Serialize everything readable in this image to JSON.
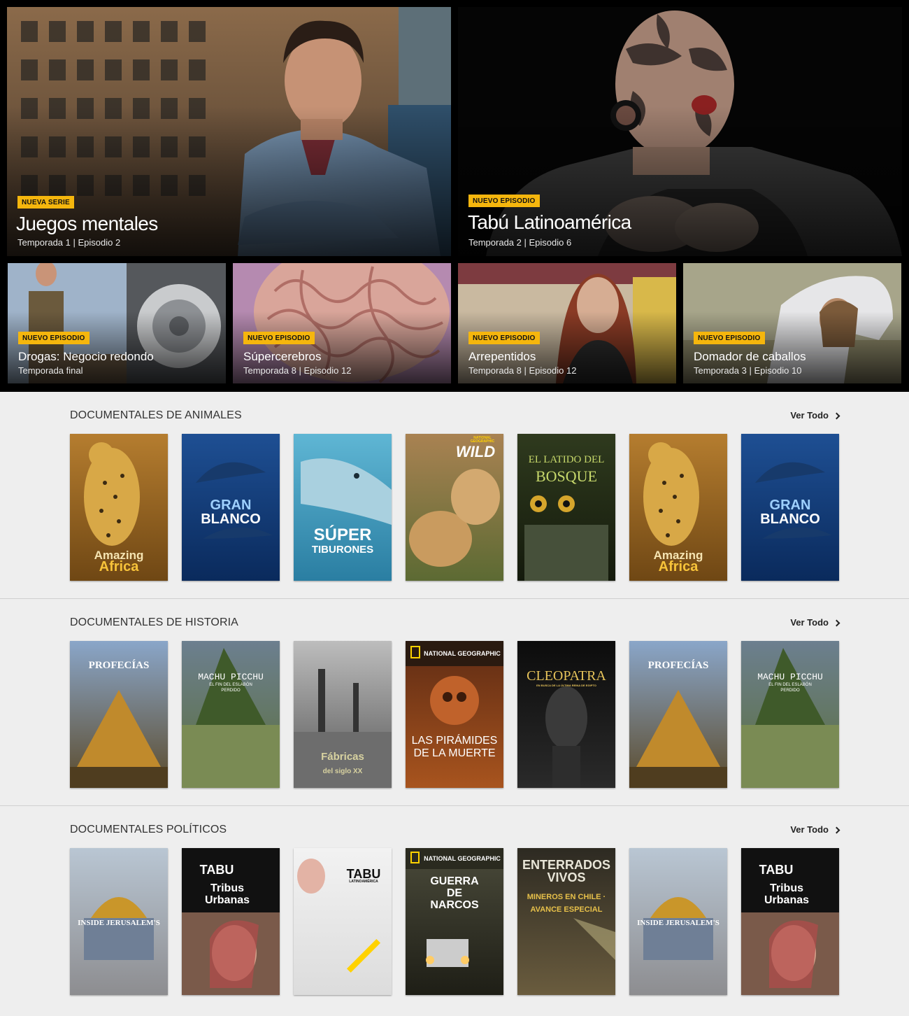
{
  "hero": {
    "featured": [
      {
        "badge": "NUEVA SERIE",
        "title": "Juegos mentales",
        "subtitle": "Temporada 1 | Episodio 2"
      },
      {
        "badge": "NUEVO EPISODIO",
        "title": "Tabú Latinoamérica",
        "subtitle": "Temporada 2 | Episodio 6"
      }
    ],
    "episodes": [
      {
        "badge": "NUEVO EPISODIO",
        "title": "Drogas: Negocio redondo",
        "subtitle": "Temporada final"
      },
      {
        "badge": "NUEVO EPISODIO",
        "title": "Súpercerebros",
        "subtitle": "Temporada 8 | Episodio 12"
      },
      {
        "badge": "NUEVO EPISODIO",
        "title": "Arrepentidos",
        "subtitle": "Temporada 8 | Episodio 12"
      },
      {
        "badge": "NUEVO EPISODIO",
        "title": "Domador de caballos",
        "subtitle": "Temporada 3 | Episodio 10"
      }
    ]
  },
  "rows": [
    {
      "title": "DOCUMENTALES DE ANIMALES",
      "see_all": "Ver Todo",
      "posters": [
        {
          "line1": "Amazing",
          "line2": "Africa"
        },
        {
          "line1": "GRAN",
          "line2": "BLANCO"
        },
        {
          "line1": "SÚPER",
          "line2": "TIBURONES"
        },
        {
          "line1": "WILD",
          "line2": "NATIONAL GEOGRAPHIC"
        },
        {
          "line1": "EL LATIDO DEL",
          "line2": "BOSQUE"
        },
        {
          "line1": "Amazing",
          "line2": "Africa"
        },
        {
          "line1": "GRAN",
          "line2": "BLANCO"
        }
      ]
    },
    {
      "title": "DOCUMENTALES DE HISTORIA",
      "see_all": "Ver Todo",
      "posters": [
        {
          "line1": "PROFECÍAS",
          "line2": ""
        },
        {
          "line1": "MACHU PICCHU",
          "line2": "EL FIN DEL ESLABÓN PERDIDO"
        },
        {
          "line1": "Fábricas",
          "line2": "del siglo XX"
        },
        {
          "line1": "NATIONAL GEOGRAPHIC",
          "line2": "LAS PIRÁMIDES DE LA MUERTE"
        },
        {
          "line1": "CLEOPATRA",
          "line2": "EN BUSCA DE LA ÚLTIMA REINA DE EGIPTO"
        },
        {
          "line1": "PROFECÍAS",
          "line2": ""
        },
        {
          "line1": "MACHU PICCHU",
          "line2": "EL FIN DEL ESLABÓN PERDIDO"
        }
      ]
    },
    {
      "title": "DOCUMENTALES POLÍTICOS",
      "see_all": "Ver Todo",
      "posters": [
        {
          "line1": "INSIDE JERUSALEM'S",
          "line2": ""
        },
        {
          "line1": "TABU",
          "line2": "Tribus Urbanas"
        },
        {
          "line1": "TABU",
          "line2": "LATINOAMÉRICA"
        },
        {
          "line1": "NATIONAL GEOGRAPHIC",
          "line2": "GUERRA DE NARCOS"
        },
        {
          "line1": "ENTERRADOS VIVOS",
          "line2": "MINEROS EN CHILE · AVANCE ESPECIAL"
        },
        {
          "line1": "INSIDE JERUSALEM'S",
          "line2": ""
        },
        {
          "line1": "TABU",
          "line2": "Tribus Urbanas"
        }
      ]
    }
  ],
  "colors": {
    "badge": "#f5b60d",
    "catalog_bg": "#eeeeee",
    "hero_bg": "#000000"
  }
}
